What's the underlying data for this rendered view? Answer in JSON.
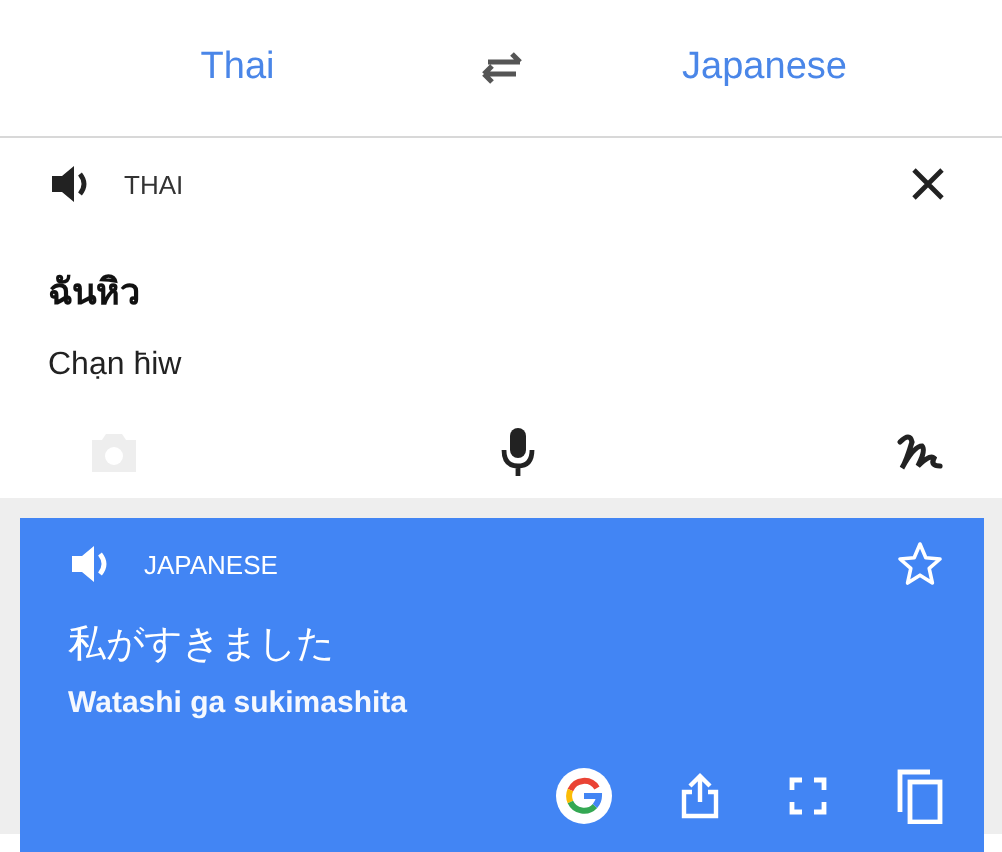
{
  "languages": {
    "source": "Thai",
    "target": "Japanese"
  },
  "source": {
    "label": "THAI",
    "text": "ฉันหิว",
    "romanization": "Chạn h̄iw",
    "tools": [
      {
        "kind": "camera",
        "disabled": true
      },
      {
        "kind": "mic",
        "disabled": false
      },
      {
        "kind": "handwriting",
        "disabled": false
      }
    ]
  },
  "result": {
    "label": "JAPANESE",
    "text": "私がすきました",
    "romanization": "Watashi ga sukimashita",
    "starred": false
  }
}
